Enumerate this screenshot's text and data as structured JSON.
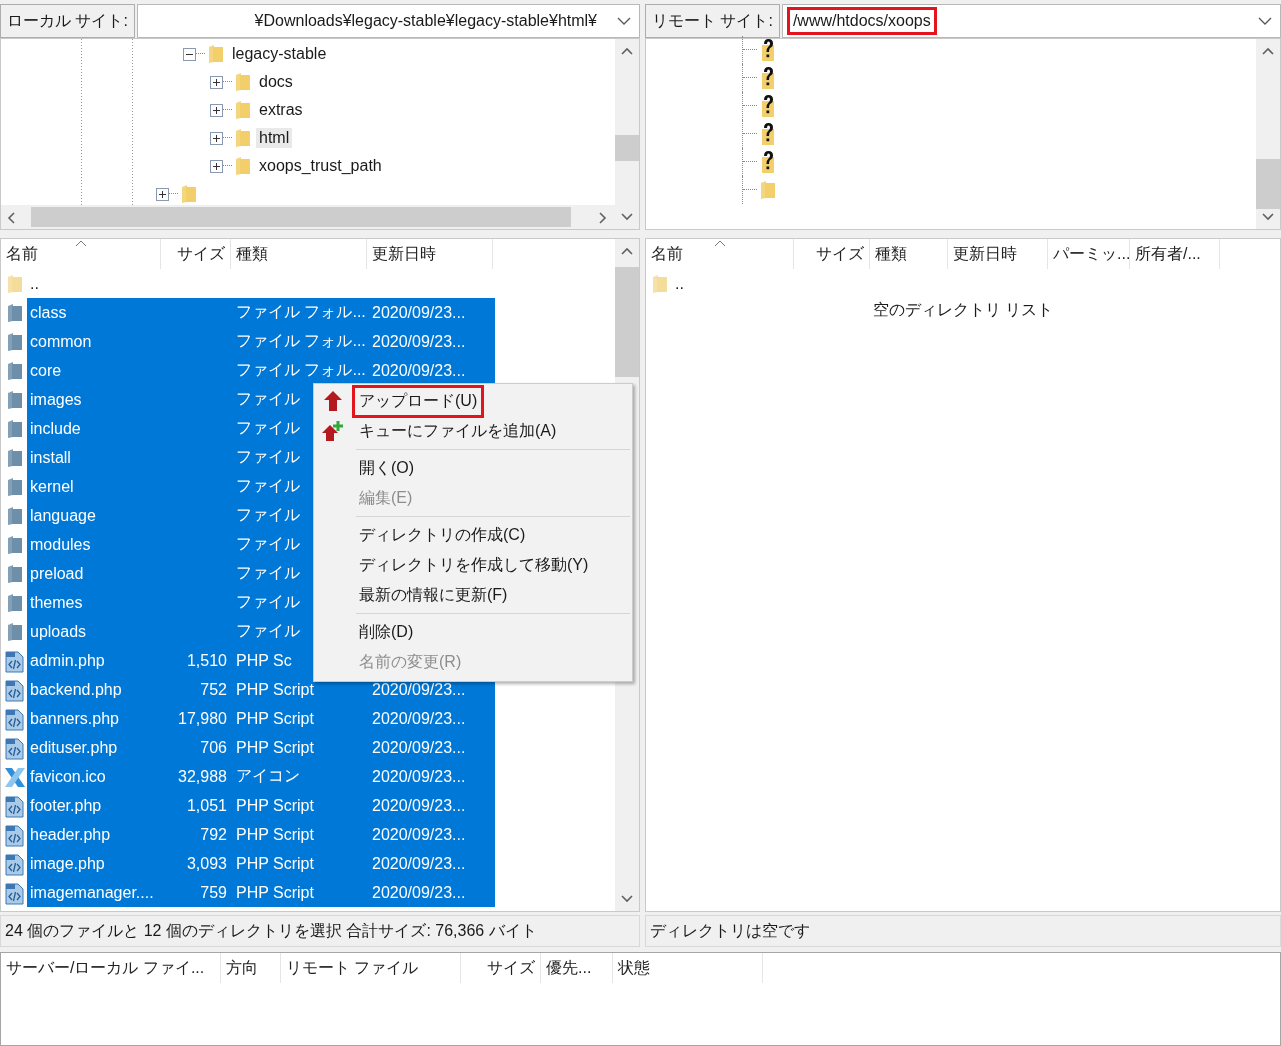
{
  "local_site": {
    "label": "ローカル サイト:",
    "path": "¥Downloads¥legacy-stable¥legacy-stable¥html¥"
  },
  "local_tree": [
    {
      "kind": "hidden",
      "children": [
        {
          "kind": "folder",
          "label": "legacy-stable",
          "expanded": true,
          "selected": false,
          "children": [
            {
              "kind": "folder",
              "label": "docs",
              "expanded": false,
              "selected": false
            },
            {
              "kind": "folder",
              "label": "extras",
              "expanded": false,
              "selected": false
            },
            {
              "kind": "folder",
              "label": "html",
              "expanded": false,
              "selected": true
            },
            {
              "kind": "folder",
              "label": "xoops_trust_path",
              "expanded": false,
              "selected": false
            }
          ]
        }
      ]
    },
    {
      "kind": "folder",
      "expanded": false,
      "selected": false
    }
  ],
  "remote_site": {
    "label": "リモート サイト:",
    "path": "/www/htdocs/xoops",
    "highlighted": true
  },
  "remote_tree": [
    {
      "kind": "unknown"
    },
    {
      "kind": "unknown"
    },
    {
      "kind": "unknown"
    },
    {
      "kind": "unknown"
    },
    {
      "kind": "unknown"
    },
    {
      "kind": "folder"
    }
  ],
  "local_files": {
    "columns": [
      {
        "label": "名前",
        "sorted": true
      },
      {
        "label": "サイズ",
        "sorted": false
      },
      {
        "label": "種類",
        "sorted": false
      },
      {
        "label": "更新日時",
        "sorted": false
      }
    ],
    "rows": [
      {
        "kind": "parent",
        "name": "..",
        "selected": false
      },
      {
        "kind": "folder",
        "name": "class",
        "type": "ファイル フォル...",
        "date": "2020/09/23...",
        "selected": true
      },
      {
        "kind": "folder",
        "name": "common",
        "type": "ファイル フォル...",
        "date": "2020/09/23...",
        "selected": true
      },
      {
        "kind": "folder",
        "name": "core",
        "type": "ファイル フォル...",
        "date": "2020/09/23...",
        "selected": true
      },
      {
        "kind": "folder",
        "name": "images",
        "type": "ファイル",
        "selected": true
      },
      {
        "kind": "folder",
        "name": "include",
        "type": "ファイル",
        "selected": true
      },
      {
        "kind": "folder",
        "name": "install",
        "type": "ファイル",
        "selected": true
      },
      {
        "kind": "folder",
        "name": "kernel",
        "type": "ファイル",
        "selected": true
      },
      {
        "kind": "folder",
        "name": "language",
        "type": "ファイル",
        "selected": true
      },
      {
        "kind": "folder",
        "name": "modules",
        "type": "ファイル",
        "selected": true
      },
      {
        "kind": "folder",
        "name": "preload",
        "type": "ファイル",
        "selected": true
      },
      {
        "kind": "folder",
        "name": "themes",
        "type": "ファイル",
        "selected": true
      },
      {
        "kind": "folder",
        "name": "uploads",
        "type": "ファイル",
        "selected": true
      },
      {
        "kind": "php",
        "name": "admin.php",
        "size": "1,510",
        "type": "PHP Sc",
        "selected": true
      },
      {
        "kind": "php",
        "name": "backend.php",
        "size": "752",
        "type": "PHP Script",
        "date": "2020/09/23...",
        "selected": true
      },
      {
        "kind": "php",
        "name": "banners.php",
        "size": "17,980",
        "type": "PHP Script",
        "date": "2020/09/23...",
        "selected": true
      },
      {
        "kind": "php",
        "name": "edituser.php",
        "size": "706",
        "type": "PHP Script",
        "date": "2020/09/23...",
        "selected": true
      },
      {
        "kind": "ico",
        "name": "favicon.ico",
        "size": "32,988",
        "type": "アイコン",
        "date": "2020/09/23...",
        "selected": true
      },
      {
        "kind": "php",
        "name": "footer.php",
        "size": "1,051",
        "type": "PHP Script",
        "date": "2020/09/23...",
        "selected": true
      },
      {
        "kind": "php",
        "name": "header.php",
        "size": "792",
        "type": "PHP Script",
        "date": "2020/09/23...",
        "selected": true
      },
      {
        "kind": "php",
        "name": "image.php",
        "size": "3,093",
        "type": "PHP Script",
        "date": "2020/09/23...",
        "selected": true
      },
      {
        "kind": "php",
        "name": "imagemanager....",
        "size": "759",
        "type": "PHP Script",
        "date": "2020/09/23...",
        "selected": true
      }
    ]
  },
  "local_status": "24 個のファイルと 12 個のディレクトリを選択 合計サイズ: 76,366 バイト",
  "remote_files": {
    "columns": [
      {
        "label": "名前",
        "sorted": true
      },
      {
        "label": "サイズ",
        "sorted": false
      },
      {
        "label": "種類",
        "sorted": false
      },
      {
        "label": "更新日時",
        "sorted": false
      },
      {
        "label": "パーミッ...",
        "sorted": false
      },
      {
        "label": "所有者/...",
        "sorted": false
      }
    ],
    "rows": [
      {
        "kind": "parent",
        "name": "..",
        "selected": false
      }
    ],
    "empty_message": "空のディレクトリ リスト"
  },
  "remote_status": "ディレクトリは空です",
  "context_menu": {
    "items": [
      {
        "kind": "item",
        "label": "アップロード(U)",
        "disabled": false,
        "highlighted": true
      },
      {
        "kind": "item",
        "label": "キューにファイルを追加(A)",
        "disabled": false,
        "highlighted": false
      },
      {
        "kind": "separator"
      },
      {
        "kind": "item",
        "label": "開く(O)",
        "disabled": false,
        "highlighted": false
      },
      {
        "kind": "item",
        "label": "編集(E)",
        "disabled": true,
        "highlighted": false
      },
      {
        "kind": "separator"
      },
      {
        "kind": "item",
        "label": "ディレクトリの作成(C)",
        "disabled": false,
        "highlighted": false
      },
      {
        "kind": "item",
        "label": "ディレクトリを作成して移動(Y)",
        "disabled": false,
        "highlighted": false
      },
      {
        "kind": "item",
        "label": "最新の情報に更新(F)",
        "disabled": false,
        "highlighted": false
      },
      {
        "kind": "separator"
      },
      {
        "kind": "item",
        "label": "削除(D)",
        "disabled": false,
        "highlighted": false
      },
      {
        "kind": "item",
        "label": "名前の変更(R)",
        "disabled": true,
        "highlighted": false
      }
    ]
  },
  "queue": {
    "columns": [
      {
        "label": "サーバー/ローカル ファイ..."
      },
      {
        "label": "方向"
      },
      {
        "label": "リモート ファイル"
      },
      {
        "label": "サイズ"
      },
      {
        "label": "優先..."
      },
      {
        "label": "状態"
      }
    ]
  }
}
